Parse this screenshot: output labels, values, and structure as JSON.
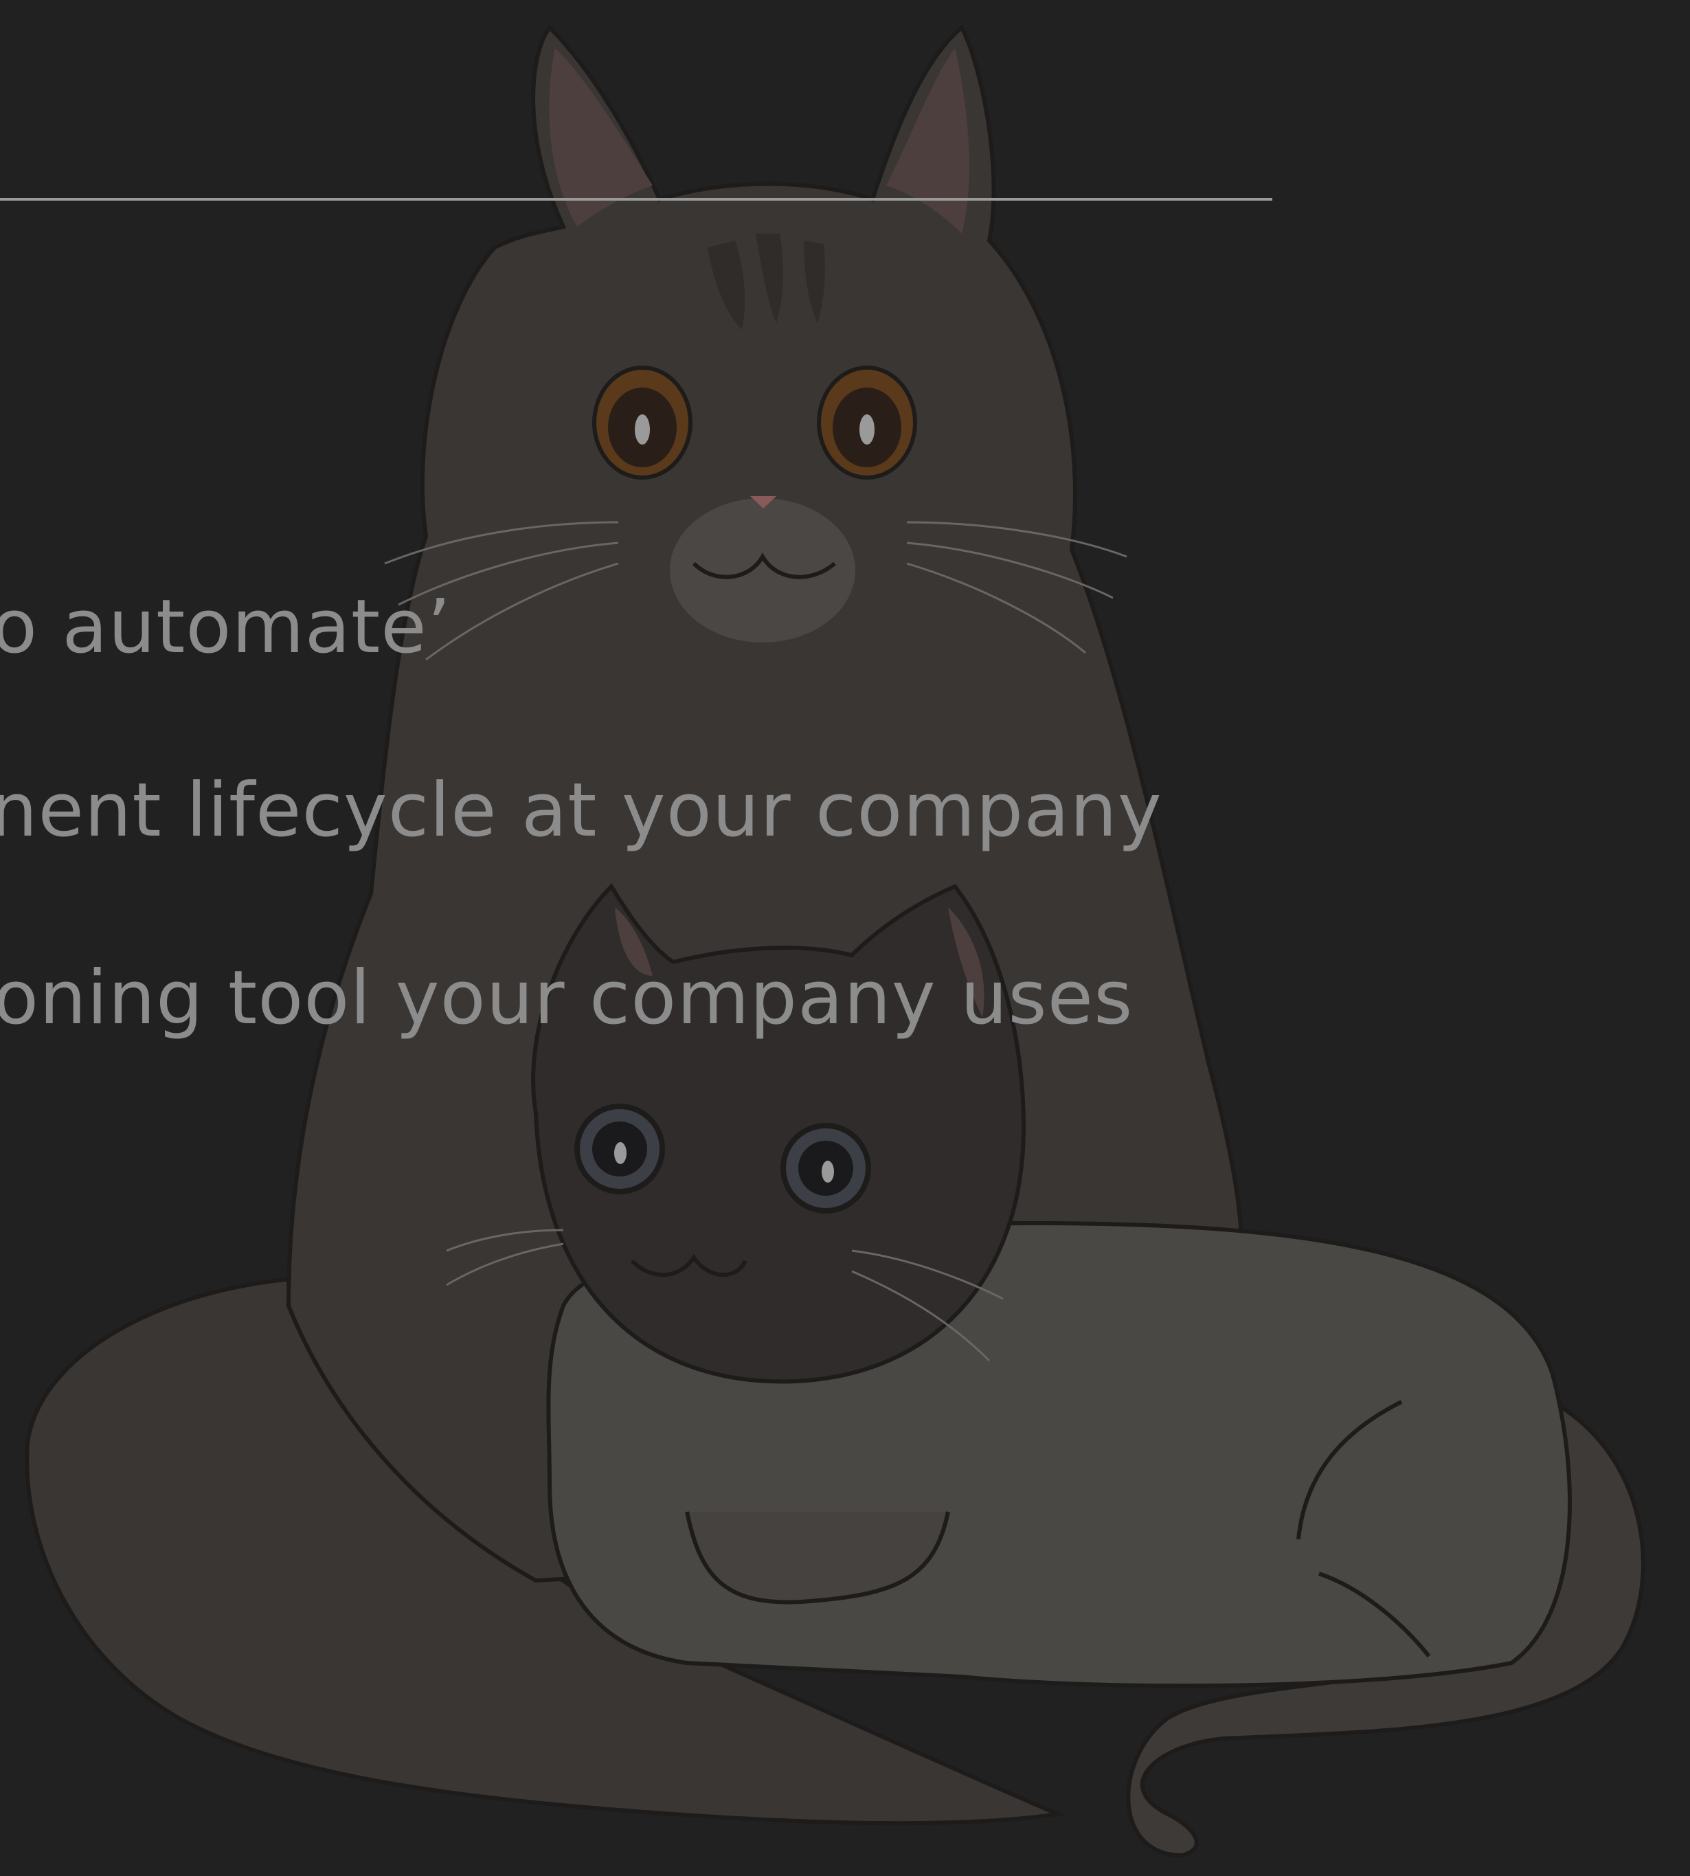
{
  "slide": {
    "bullets": [
      {
        "text": "o automate’"
      },
      {
        "text": "nent lifecycle at your company"
      },
      {
        "text": "oning tool your company uses"
      }
    ]
  },
  "colors": {
    "background": "#212121",
    "text": "#8c8c8c",
    "rule": "#9a9a9a",
    "cat_dark_fur": "#3a3634",
    "cat_light_body": "#4a4845",
    "cat_face_mask": "#2f2c2b"
  },
  "icons": {
    "illustration": "two-cats-illustration"
  }
}
